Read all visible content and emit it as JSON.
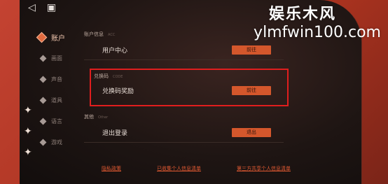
{
  "window": {
    "back_icon": "back-triangle-icon",
    "square_icon": "square-icon"
  },
  "watermark": {
    "line1": "娱乐木风",
    "line2": "ylmfwin100.com"
  },
  "sidebar": {
    "items": [
      {
        "label": "账户",
        "active": true
      },
      {
        "label": "画面",
        "active": false
      },
      {
        "label": "声音",
        "active": false
      },
      {
        "label": "道具",
        "active": false
      },
      {
        "label": "语言",
        "active": false
      },
      {
        "label": "游戏",
        "active": false
      }
    ]
  },
  "sections": {
    "account": {
      "title": "账户信息",
      "subtitle": "ACC",
      "row_label": "用户中心",
      "button": "前往"
    },
    "redeem": {
      "title": "兑换码",
      "subtitle": "CODE",
      "row_label": "兑换码奖励",
      "button": "前往"
    },
    "other": {
      "title": "其他",
      "subtitle": "Other",
      "row_label": "退出登录",
      "button": "退出"
    }
  },
  "bottom_links": [
    "隐私政策",
    "已收集个人信息清单",
    "第三方共享个人信息清单"
  ],
  "colors": {
    "accent": "#d4572c",
    "highlight": "#e01e1e",
    "frame": "#b8392a"
  }
}
